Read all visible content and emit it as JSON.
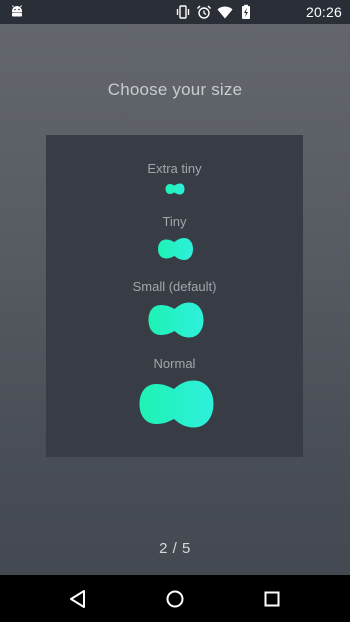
{
  "status_bar": {
    "time": "20:26",
    "icons": [
      "android-icon",
      "vibrate-icon",
      "alarm-icon",
      "wifi-icon",
      "battery-charging-icon"
    ]
  },
  "screen": {
    "title": "Choose your size",
    "options": [
      {
        "label": "Extra tiny"
      },
      {
        "label": "Tiny"
      },
      {
        "label": "Small (default)"
      },
      {
        "label": "Normal"
      }
    ],
    "pager": "2 / 5",
    "accent_color_start": "#1ef2b4",
    "accent_color_end": "#2ef0dc"
  },
  "nav_bar": {
    "buttons": [
      "back-icon",
      "home-icon",
      "recents-icon"
    ]
  }
}
